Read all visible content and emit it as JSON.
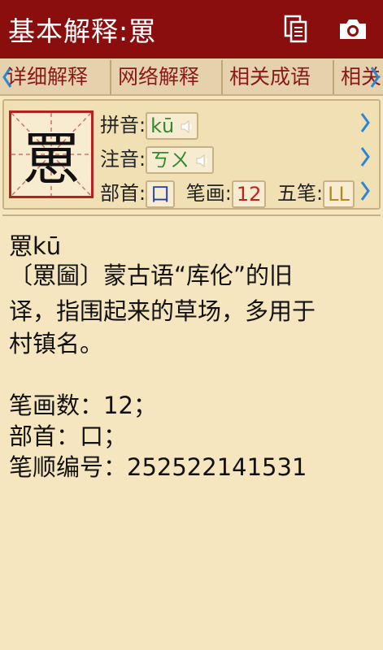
{
  "header": {
    "title": "基本解释:罳"
  },
  "tabs": [
    {
      "label": "详细解释"
    },
    {
      "label": "网络解释"
    },
    {
      "label": "相关成语"
    },
    {
      "label": "相关"
    }
  ],
  "char": {
    "glyph": "罳",
    "pinyin_label": "拼音:",
    "pinyin": "kū",
    "zhuyin_label": "注音:",
    "zhuyin": "ㄎㄨ",
    "radical_label": "部首:",
    "radical": "口",
    "strokes_label": "笔画:",
    "strokes": "12",
    "wubi_label": "五笔:",
    "wubi": "LL"
  },
  "explanation": {
    "lines": [
      "罳kū",
      "〔罳圙〕蒙古语“库伦”的旧",
      "译，指围起来的草场，多用于",
      "村镇名。",
      "",
      "笔画数：12；",
      "部首：口；",
      "笔顺编号：252522141531"
    ]
  },
  "colors": {
    "titlebar": "#8a0e0e",
    "background": "#f6e6bf",
    "tab_text": "#8a1a1a",
    "pinyin": "#2e8b2e",
    "arrow": "#2a86d6"
  }
}
